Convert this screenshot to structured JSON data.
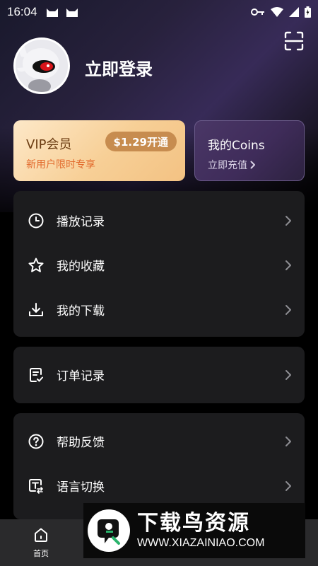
{
  "status_bar": {
    "time": "16:04"
  },
  "header": {
    "login_text": "立即登录"
  },
  "vip": {
    "title": "VIP会员",
    "price_label": "$1.29开通",
    "subtitle": "新用户限时专享"
  },
  "coins": {
    "title": "我的Coins",
    "subtitle": "立即充值"
  },
  "menu_group_1": [
    {
      "label": "播放记录",
      "icon": "history-icon"
    },
    {
      "label": "我的收藏",
      "icon": "star-icon"
    },
    {
      "label": "我的下载",
      "icon": "download-icon"
    }
  ],
  "menu_group_2": [
    {
      "label": "订单记录",
      "icon": "order-icon"
    }
  ],
  "menu_group_3": [
    {
      "label": "帮助反馈",
      "icon": "help-icon"
    },
    {
      "label": "语言切换",
      "icon": "language-icon"
    }
  ],
  "bottom_nav": {
    "home_label": "首页"
  },
  "watermark": {
    "title": "下载鸟资源",
    "url": "WWW.XIAZAINIAO.COM"
  },
  "colors": {
    "accent_vip": "#f7cf96",
    "accent_coins": "#3f2c5a",
    "card_bg": "#1c1c1e"
  }
}
